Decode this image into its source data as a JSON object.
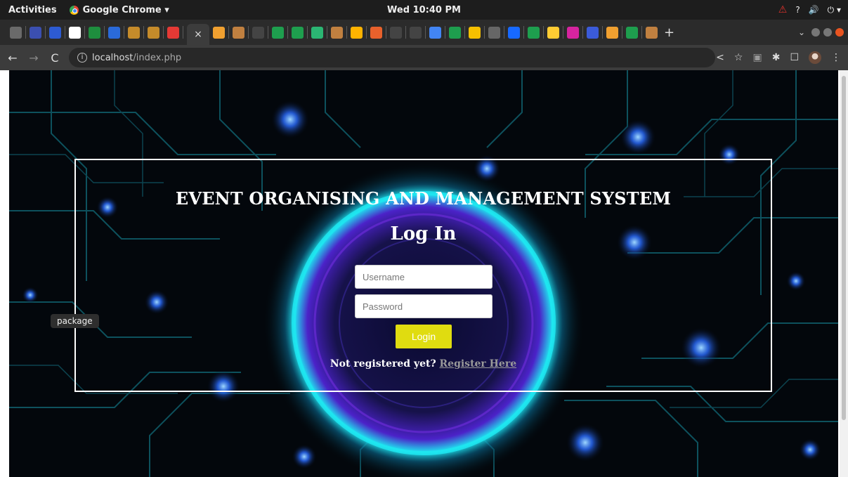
{
  "os": {
    "activities_label": "Activities",
    "app_label": "Google Chrome ▾",
    "clock": "Wed 10:40 PM",
    "tray_question": "?",
    "tray_volume": "🔊",
    "tray_power": "⏻ ▾"
  },
  "browser": {
    "tab_close": "×",
    "new_tab": "+",
    "tab_list_chevron": "⌄",
    "url_host": "localhost",
    "url_path": "/index.php",
    "favicons": [
      "#6a6a6a",
      "#3b4fb0",
      "#2d5bd2",
      "#ffffff",
      "#1e8e3e",
      "#2a6ad9",
      "#c58b2a",
      "#c58b2a",
      "#e53935",
      "#f0a030",
      "#c08040",
      "#444444",
      "#1e9e4e",
      "#1e9e4e",
      "#2bb673",
      "#c08040",
      "#ffb300",
      "#e8612c",
      "#444444",
      "#444444",
      "#4285f4",
      "#1e9e4e",
      "#f6c000",
      "#666666",
      "#1769ff",
      "#1e9e4e",
      "#ffcc33",
      "#d6249f",
      "#3b5bd9",
      "#f0a030",
      "#1e9e4e",
      "#c08040"
    ]
  },
  "page": {
    "system_title": "EVENT ORGANISING AND MANAGEMENT SYSTEM",
    "login_heading": "Log In",
    "username_placeholder": "Username",
    "password_placeholder": "Password",
    "login_button": "Login",
    "not_registered_text": "Not registered yet?",
    "register_link": "Register Here",
    "tooltip": "package"
  },
  "colors": {
    "accent_button": "#e0dc10",
    "glow_cyan": "#1ee6f0",
    "glow_purple": "#6a2bd6"
  }
}
